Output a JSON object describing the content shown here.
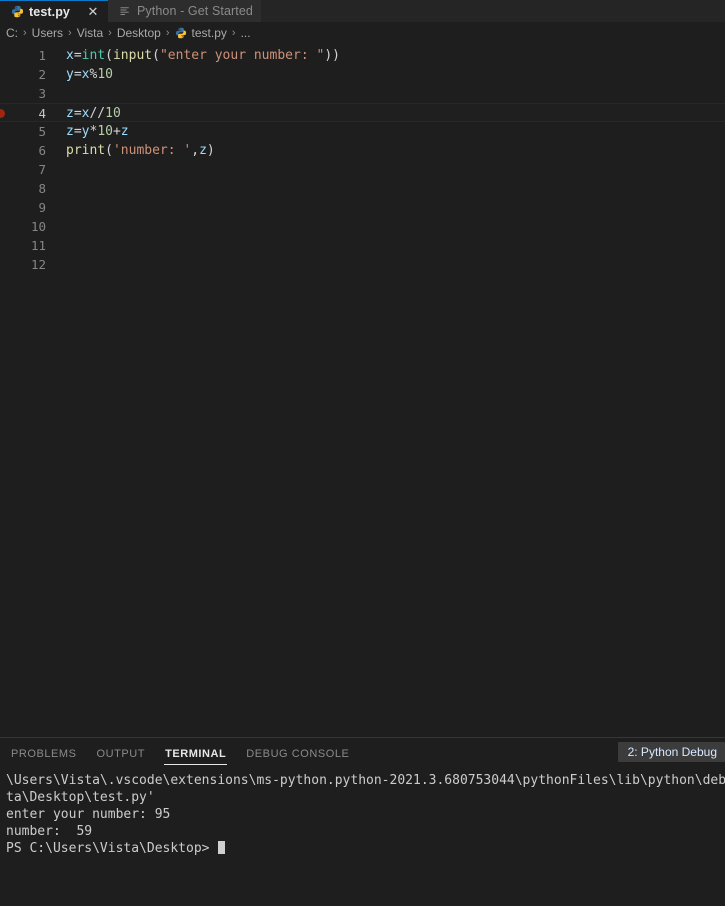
{
  "tabs": [
    {
      "label": "test.py",
      "icon": "python-icon",
      "active": true,
      "close_label": "✕"
    },
    {
      "label": "Python - Get Started",
      "icon": "list-icon",
      "active": false
    }
  ],
  "breadcrumb": {
    "separator": "›",
    "items": [
      {
        "label": "C:"
      },
      {
        "label": "Users"
      },
      {
        "label": "Vista"
      },
      {
        "label": "Desktop"
      },
      {
        "label": "test.py",
        "icon": "python-icon"
      },
      {
        "label": "..."
      }
    ]
  },
  "editor": {
    "total_lines": 12,
    "active_line": 4,
    "breakpoint_line": 4,
    "lines": [
      {
        "num": "1",
        "tokens": [
          {
            "t": "x",
            "c": "t-var"
          },
          {
            "t": "=",
            "c": "t-op"
          },
          {
            "t": "int",
            "c": "t-type"
          },
          {
            "t": "(",
            "c": "t-punc"
          },
          {
            "t": "input",
            "c": "t-fn"
          },
          {
            "t": "(",
            "c": "t-punc"
          },
          {
            "t": "\"enter your number: \"",
            "c": "t-str"
          },
          {
            "t": "))",
            "c": "t-punc"
          }
        ]
      },
      {
        "num": "2",
        "tokens": [
          {
            "t": "y",
            "c": "t-var"
          },
          {
            "t": "=",
            "c": "t-op"
          },
          {
            "t": "x",
            "c": "t-var"
          },
          {
            "t": "%",
            "c": "t-op"
          },
          {
            "t": "10",
            "c": "t-num"
          }
        ]
      },
      {
        "num": "3",
        "tokens": []
      },
      {
        "num": "4",
        "tokens": [
          {
            "t": "z",
            "c": "t-var"
          },
          {
            "t": "=",
            "c": "t-op"
          },
          {
            "t": "x",
            "c": "t-var"
          },
          {
            "t": "//",
            "c": "t-op"
          },
          {
            "t": "10",
            "c": "t-num"
          }
        ]
      },
      {
        "num": "5",
        "tokens": [
          {
            "t": "z",
            "c": "t-var"
          },
          {
            "t": "=",
            "c": "t-op"
          },
          {
            "t": "y",
            "c": "t-var"
          },
          {
            "t": "*",
            "c": "t-op"
          },
          {
            "t": "10",
            "c": "t-num"
          },
          {
            "t": "+",
            "c": "t-op"
          },
          {
            "t": "z",
            "c": "t-var"
          }
        ]
      },
      {
        "num": "6",
        "tokens": [
          {
            "t": "print",
            "c": "t-fn"
          },
          {
            "t": "(",
            "c": "t-punc"
          },
          {
            "t": "'number: '",
            "c": "t-str"
          },
          {
            "t": ",",
            "c": "t-punc"
          },
          {
            "t": "z",
            "c": "t-var"
          },
          {
            "t": ")",
            "c": "t-punc"
          }
        ]
      },
      {
        "num": "7",
        "tokens": []
      },
      {
        "num": "8",
        "tokens": []
      },
      {
        "num": "9",
        "tokens": []
      },
      {
        "num": "10",
        "tokens": []
      },
      {
        "num": "11",
        "tokens": []
      },
      {
        "num": "12",
        "tokens": []
      }
    ]
  },
  "panel": {
    "tabs": [
      {
        "label": "PROBLEMS",
        "active": false
      },
      {
        "label": "OUTPUT",
        "active": false
      },
      {
        "label": "TERMINAL",
        "active": true
      },
      {
        "label": "DEBUG CONSOLE",
        "active": false
      }
    ],
    "terminal_selector": "2: Python Debug",
    "terminal_lines": [
      "\\Users\\Vista\\.vscode\\extensions\\ms-python.python-2021.3.680753044\\pythonFiles\\lib\\python\\debugpy\\launch",
      "ta\\Desktop\\test.py'",
      "enter your number: 95",
      "number:  59",
      "PS C:\\Users\\Vista\\Desktop> "
    ]
  },
  "colors": {
    "editor_bg": "#1e1e1e",
    "tabbar_bg": "#252526",
    "active_tab_border": "#0a7aca",
    "breakpoint_red": "#a1260d",
    "selector_bg": "#3c3c3c"
  }
}
